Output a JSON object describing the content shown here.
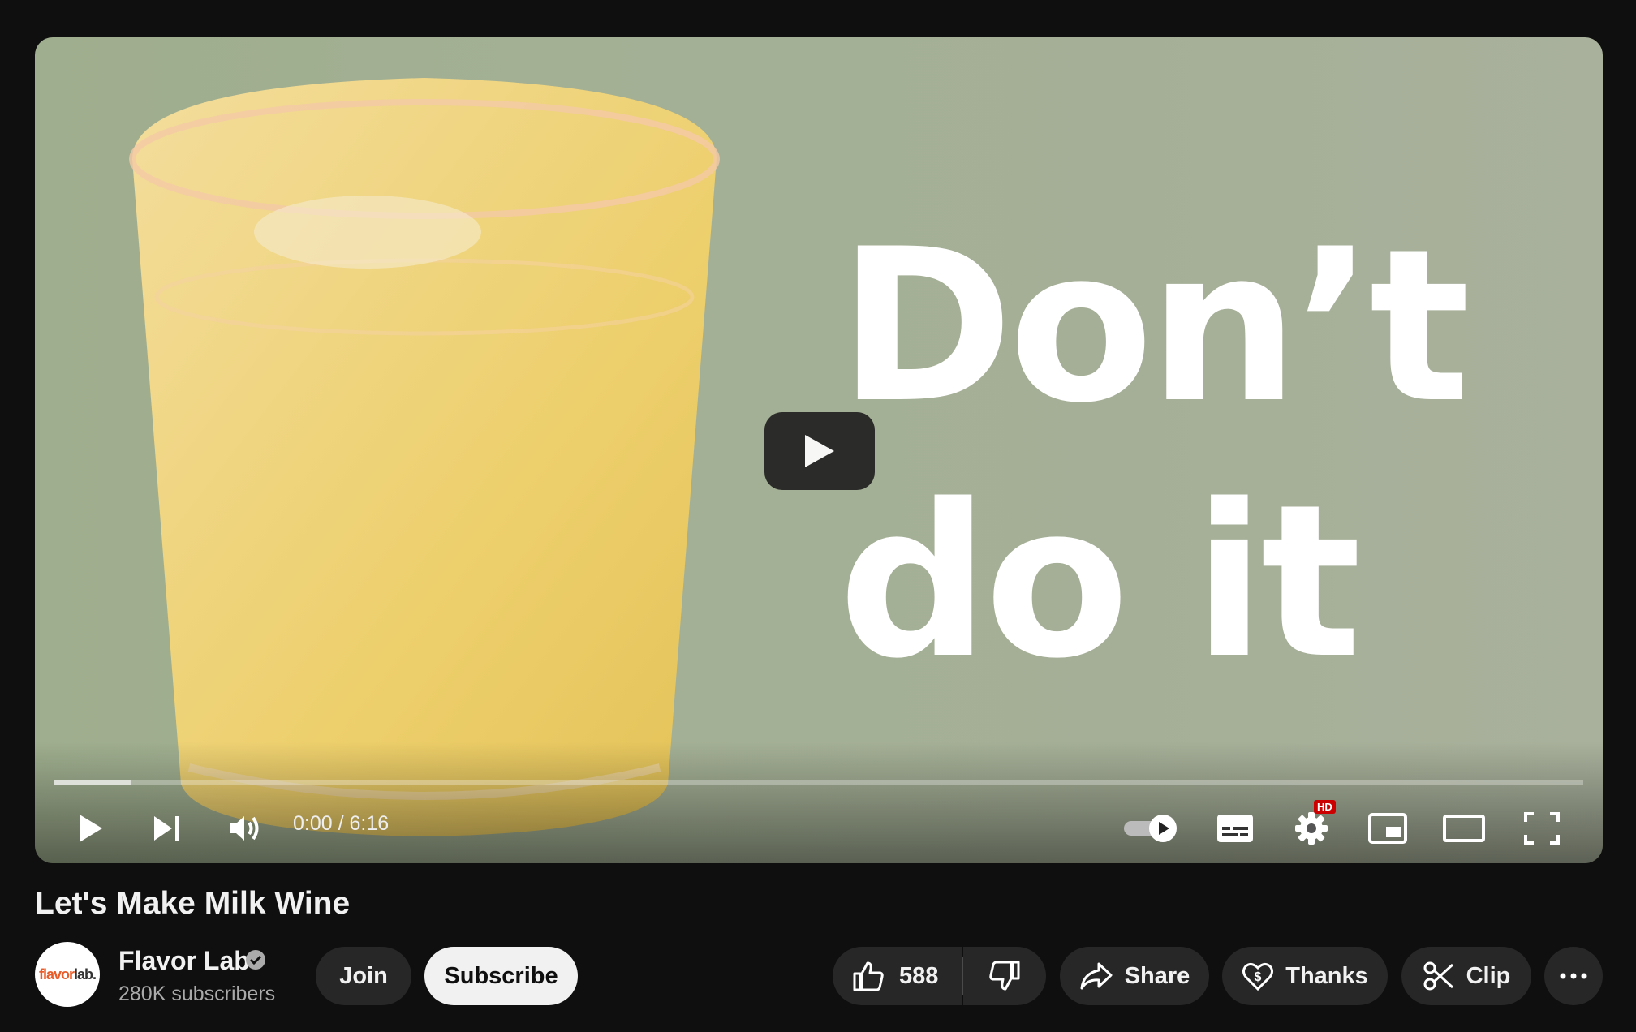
{
  "video": {
    "overlay_line1": "Don’t",
    "overlay_line2": "do it",
    "progress_loaded_fraction": 0.05,
    "time": "0:00 / 6:16",
    "settings_badge": "HD"
  },
  "title": "Let's Make Milk Wine",
  "channel": {
    "logo_text_1": "flavor",
    "logo_text_2": "lab.",
    "name": "Flavor Lab",
    "subscribers": "280K subscribers"
  },
  "actions": {
    "join": "Join",
    "subscribe": "Subscribe",
    "likes": "588",
    "share": "Share",
    "thanks": "Thanks",
    "clip": "Clip"
  },
  "colors": {
    "background": "#0f0f0f",
    "pill": "#272727",
    "badge": "#cc0000"
  }
}
